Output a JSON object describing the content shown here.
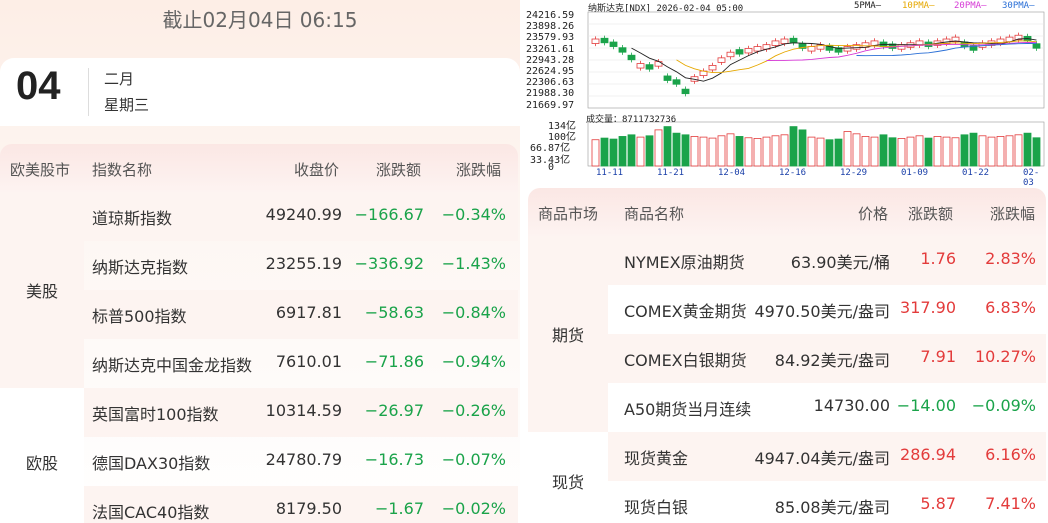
{
  "date_header": "截止02月04日 06:15",
  "date": {
    "day": "04",
    "month": "二月",
    "weekday": "星期三"
  },
  "stocks": {
    "headers": {
      "market": "欧美股市",
      "name": "指数名称",
      "close": "收盘价",
      "change": "涨跌额",
      "pct": "涨跌幅"
    },
    "groups": [
      {
        "label": "美股",
        "rows": [
          {
            "name": "道琼斯指数",
            "close": "49240.99",
            "change": "−166.67",
            "pct": "−0.34%"
          },
          {
            "name": "纳斯达克指数",
            "close": "23255.19",
            "change": "−336.92",
            "pct": "−1.43%"
          },
          {
            "name": "标普500指数",
            "close": "6917.81",
            "change": "−58.63",
            "pct": "−0.84%"
          },
          {
            "name": "纳斯达克中国金龙指数",
            "close": "7610.01",
            "change": "−71.86",
            "pct": "−0.94%"
          }
        ]
      },
      {
        "label": "欧股",
        "rows": [
          {
            "name": "英国富时100指数",
            "close": "10314.59",
            "change": "−26.97",
            "pct": "−0.26%"
          },
          {
            "name": "德国DAX30指数",
            "close": "24780.79",
            "change": "−16.73",
            "pct": "−0.07%"
          },
          {
            "name": "法国CAC40指数",
            "close": "8179.50",
            "change": "−1.67",
            "pct": "−0.02%"
          }
        ]
      }
    ]
  },
  "chart": {
    "title": "纳斯达克[NDX] 2026-02-04 05:00",
    "ma_labels": [
      "5PMA—",
      "10PMA—",
      "20PMA—",
      "30PMA—"
    ],
    "ma_colors": [
      "#222222",
      "#e6a800",
      "#d63bd6",
      "#2a6fd6"
    ],
    "y_ticks": [
      "24216.59",
      "23898.26",
      "23579.93",
      "23261.61",
      "22943.28",
      "22624.95",
      "22306.63",
      "21988.30",
      "21669.97"
    ],
    "volume_label": "成交量：8711732736",
    "vol_ticks": [
      "134亿",
      "100亿",
      "66.87亿",
      "33.43亿",
      "0"
    ],
    "x_ticks": [
      "11-11",
      "11-21",
      "12-04",
      "12-16",
      "12-29",
      "01-09",
      "01-22",
      "02-03"
    ]
  },
  "chart_data": {
    "type": "candlestick",
    "title": "纳斯达克[NDX] 2026-02-04 05:00",
    "y_range": [
      21669.97,
      24216.59
    ],
    "volume_range": [
      0,
      134
    ],
    "x_ticks": [
      "11-11",
      "11-21",
      "12-04",
      "12-16",
      "12-29",
      "01-09",
      "01-22",
      "02-03"
    ],
    "close": [
      23500,
      23400,
      23300,
      23150,
      22950,
      22850,
      22700,
      22900,
      22400,
      22300,
      22050,
      22500,
      22650,
      22800,
      23000,
      23150,
      23100,
      23250,
      23300,
      23350,
      23450,
      23500,
      23400,
      23250,
      23300,
      23350,
      23200,
      23150,
      23300,
      23350,
      23400,
      23450,
      23300,
      23250,
      23350,
      23400,
      23450,
      23300,
      23450,
      23500,
      23550,
      23300,
      23200,
      23400,
      23450,
      23500,
      23550,
      23600,
      23450,
      23255
    ],
    "up": [
      true,
      false,
      false,
      false,
      false,
      true,
      false,
      true,
      false,
      false,
      false,
      true,
      true,
      true,
      true,
      true,
      false,
      true,
      true,
      true,
      true,
      true,
      false,
      false,
      true,
      true,
      false,
      false,
      true,
      true,
      true,
      true,
      false,
      false,
      true,
      true,
      true,
      false,
      true,
      true,
      true,
      false,
      false,
      true,
      true,
      true,
      true,
      true,
      false,
      false
    ],
    "volume": [
      80,
      85,
      82,
      90,
      95,
      88,
      92,
      110,
      120,
      100,
      95,
      90,
      88,
      85,
      92,
      98,
      90,
      86,
      84,
      88,
      92,
      95,
      120,
      110,
      88,
      85,
      80,
      82,
      105,
      98,
      90,
      88,
      95,
      86,
      84,
      88,
      92,
      85,
      90,
      88,
      86,
      95,
      100,
      92,
      88,
      90,
      92,
      95,
      100,
      86
    ]
  },
  "commodities": {
    "headers": {
      "market": "商品市场",
      "name": "商品名称",
      "price": "价格",
      "change": "涨跌额",
      "pct": "涨跌幅"
    },
    "groups": [
      {
        "label": "期货",
        "rows": [
          {
            "name": "NYMEX原油期货",
            "price": "63.90美元/桶",
            "change": "1.76",
            "pct": "2.83%",
            "dir": "pos"
          },
          {
            "name": "COMEX黄金期货",
            "price": "4970.50美元/盎司",
            "change": "317.90",
            "pct": "6.83%",
            "dir": "pos"
          },
          {
            "name": "COMEX白银期货",
            "price": "84.92美元/盎司",
            "change": "7.91",
            "pct": "10.27%",
            "dir": "pos"
          },
          {
            "name": "A50期货当月连续",
            "price": "14730.00",
            "change": "−14.00",
            "pct": "−0.09%",
            "dir": "neg"
          }
        ]
      },
      {
        "label": "现货",
        "rows": [
          {
            "name": "现货黄金",
            "price": "4947.04美元/盎司",
            "change": "286.94",
            "pct": "6.16%",
            "dir": "pos"
          },
          {
            "name": "现货白银",
            "price": "85.08美元/盎司",
            "change": "5.87",
            "pct": "7.41%",
            "dir": "pos"
          }
        ]
      }
    ]
  }
}
